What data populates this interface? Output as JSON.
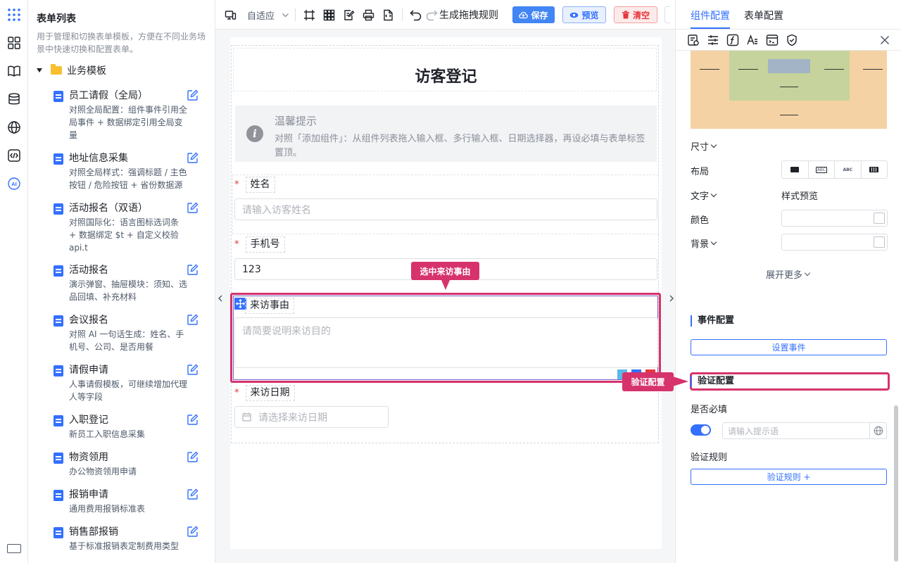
{
  "rail": {
    "icons": [
      "apps-grid-icon",
      "widgets-icon",
      "book-icon",
      "database-icon",
      "globe-icon",
      "code-icon",
      "ai-icon",
      "keyboard-icon"
    ]
  },
  "sidebar": {
    "title": "表单列表",
    "description": "用于管理和切换表单模板，方便在不同业务场景中快速切换和配置表单。",
    "folder": "业务模板",
    "items": [
      {
        "name": "员工请假（全局）",
        "desc": "对照全局配置：组件事件引用全局事件 + 数据绑定引用全局变量"
      },
      {
        "name": "地址信息采集",
        "desc": "对照全局样式：强调标题 / 主色按钮 / 危险按钮 + 省份数据源"
      },
      {
        "name": "活动报名（双语）",
        "desc": "对照国际化：语言图标选词条 + 数据绑定 $t + 自定义校验 api.t"
      },
      {
        "name": "活动报名",
        "desc": "演示弹窗、抽屉模块：须知、选品回填、补充材料"
      },
      {
        "name": "会议报名",
        "desc": "对照 AI 一句话生成：姓名、手机号、公司、是否用餐"
      },
      {
        "name": "请假申请",
        "desc": "人事请假模板，可继续增加代理人等字段"
      },
      {
        "name": "入职登记",
        "desc": "新员工入职信息采集"
      },
      {
        "name": "物资领用",
        "desc": "办公物资领用申请"
      },
      {
        "name": "报销申请",
        "desc": "通用费用报销标准表"
      },
      {
        "name": "销售部报销",
        "desc": "基于标准报销表定制费用类型"
      }
    ]
  },
  "toolbar": {
    "device_mode": "自适应",
    "generate_rule": "生成拖拽规则",
    "save": "保存",
    "preview": "预览",
    "clear": "清空"
  },
  "form": {
    "title": "访客登记",
    "alert_title": "温馨提示",
    "alert_desc": "对照「添加组件」：从组件列表拖入输入框、多行输入框、日期选择器，再设必填与表单标签置顶。",
    "fields": {
      "name_label": "姓名",
      "name_placeholder": "请输入访客姓名",
      "phone_label": "手机号",
      "phone_value": "123",
      "reason_label": "来访事由",
      "reason_placeholder": "请简要说明来访目的",
      "date_label": "来访日期",
      "date_placeholder": "请选择来访日期"
    },
    "callout_selected": "选中来访事由"
  },
  "panel": {
    "tab_component": "组件配置",
    "tab_form": "表单配置",
    "size": "尺寸",
    "layout": "布局",
    "text": "文字",
    "style_preview": "样式预览",
    "color": "颜色",
    "background": "背景",
    "expand_more": "展开更多",
    "event_section": "事件配置",
    "set_event": "设置事件",
    "validate_section": "验证配置",
    "required": "是否必填",
    "tip_placeholder": "请输入提示语",
    "rules": "验证规则",
    "add_rule": "验证规则 +",
    "callout_validate": "验证配置",
    "layout_options": [
      "block",
      "ABC",
      "ABC",
      "inline-block"
    ]
  },
  "colors": {
    "primary": "#3370ff",
    "highlight": "#d6336c",
    "danger": "#e5373a"
  }
}
